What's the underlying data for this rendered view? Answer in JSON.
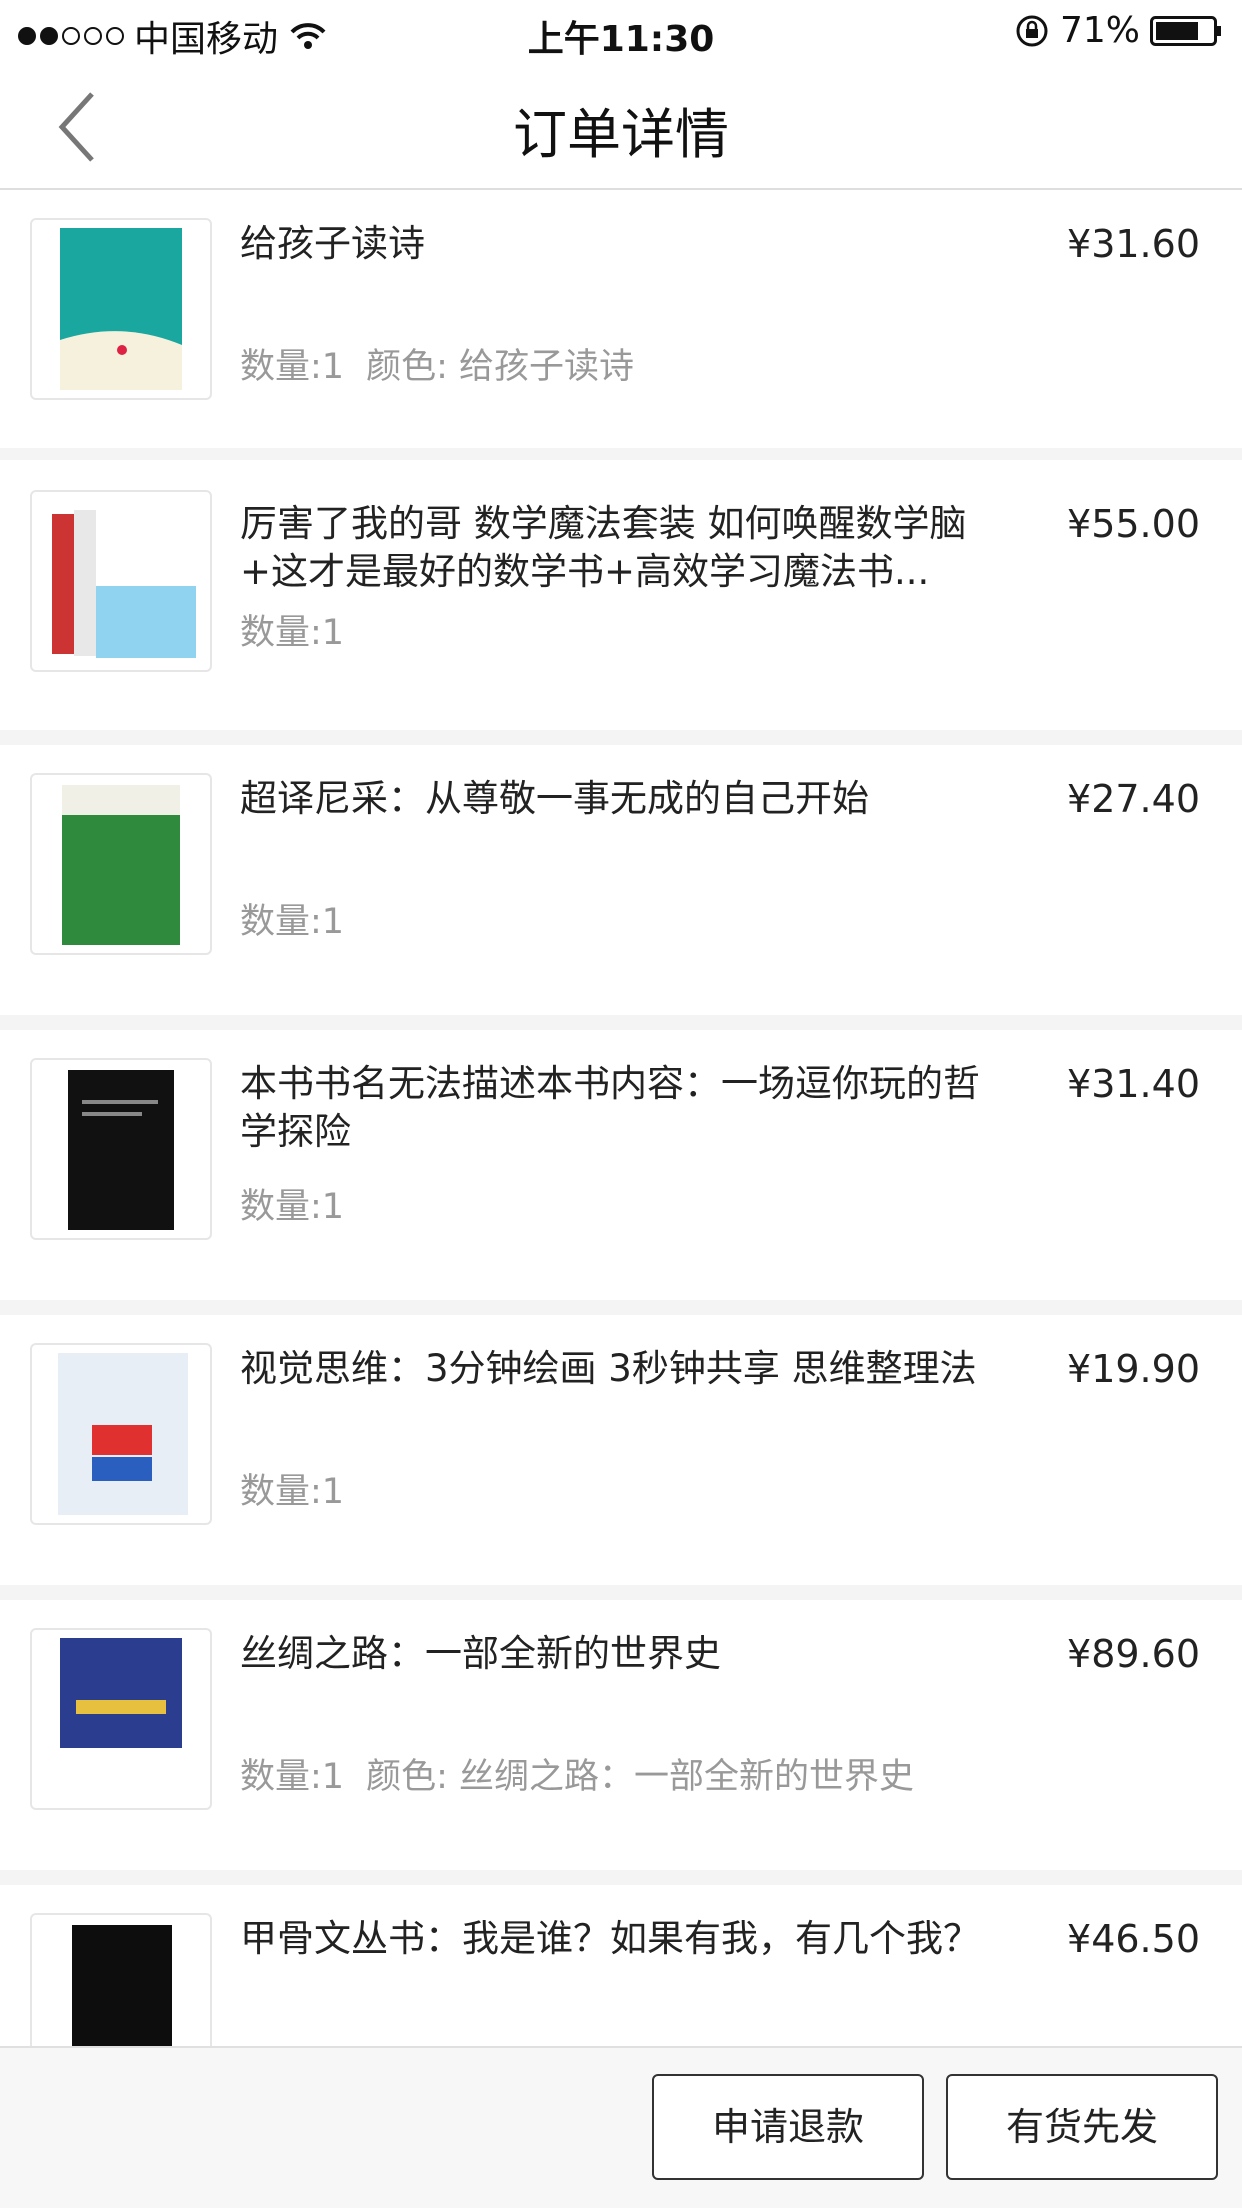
{
  "status_bar": {
    "carrier": "中国移动",
    "time": "上午11:30",
    "battery": "71%"
  },
  "nav": {
    "title": "订单详情",
    "back_icon": "chevron-left-icon"
  },
  "items": [
    {
      "title": "给孩子读诗",
      "price": "¥31.60",
      "qty": "数量:1",
      "color": "颜色: 给孩子读诗",
      "cover_color": "#1aa7a0"
    },
    {
      "title": "厉害了我的哥 数学魔法套装 如何唤醒数学脑+这才是最好的数学书+高效学习魔法书...",
      "price": "¥55.00",
      "qty": "数量:1",
      "color": "",
      "cover_color": "#8fd3f0"
    },
    {
      "title": "超译尼采：从尊敬一事无成的自己开始",
      "price": "¥27.40",
      "qty": "数量:1",
      "color": "",
      "cover_color": "#2f8a3e"
    },
    {
      "title": "本书书名无法描述本书内容：一场逗你玩的哲学探险",
      "price": "¥31.40",
      "qty": "数量:1",
      "color": "",
      "cover_color": "#111111"
    },
    {
      "title": "视觉思维：3分钟绘画 3秒钟共享 思维整理法",
      "price": "¥19.90",
      "qty": "数量:1",
      "color": "",
      "cover_color": "#e8eef6"
    },
    {
      "title": "丝绸之路：一部全新的世界史",
      "price": "¥89.60",
      "qty": "数量:1",
      "color": "颜色: 丝绸之路：一部全新的世界史",
      "cover_color": "#2a3d8f"
    },
    {
      "title": "甲骨文丛书：我是谁？如果有我，有几个我？",
      "price": "¥46.50",
      "qty": "",
      "color": "",
      "cover_color": "#0d0d0d"
    }
  ],
  "bottom_bar": {
    "refund_label": "申请退款",
    "ship_label": "有货先发"
  }
}
